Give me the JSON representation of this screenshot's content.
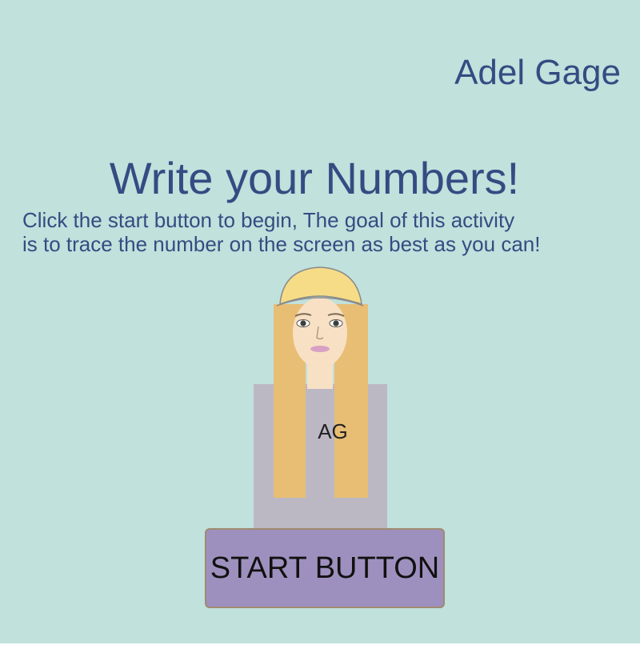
{
  "author_name": "Adel Gage",
  "title": "Write your Numbers!",
  "instructions": {
    "line1": "Click the start button to begin, The goal of this activity",
    "line2": "is to trace the number on the screen as best as you can!"
  },
  "avatar": {
    "shirt_text": "AG"
  },
  "start_button": {
    "label": "START BUTTON"
  },
  "colors": {
    "background": "#c0e1dc",
    "text": "#354b82",
    "button": "#9e90be",
    "hat": "#f6dc86",
    "hair": "#e8be74",
    "shirt": "#bbb8c4",
    "skin": "#f8e0c4"
  }
}
